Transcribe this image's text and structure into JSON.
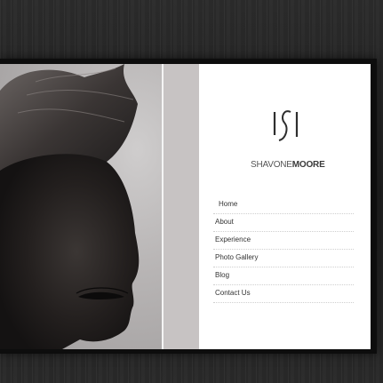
{
  "brand": {
    "monogram": "ISI",
    "first_name": "SHAVONE",
    "last_name": "MOORE"
  },
  "nav": {
    "items": [
      {
        "label": "Home"
      },
      {
        "label": "About"
      },
      {
        "label": "Experience"
      },
      {
        "label": "Photo Gallery"
      },
      {
        "label": "Blog"
      },
      {
        "label": "Contact Us"
      }
    ]
  },
  "colors": {
    "background": "#262626",
    "frame": "#0d0d0d",
    "strip": "#c7c3c3",
    "panel": "#ffffff",
    "text": "#333333"
  }
}
